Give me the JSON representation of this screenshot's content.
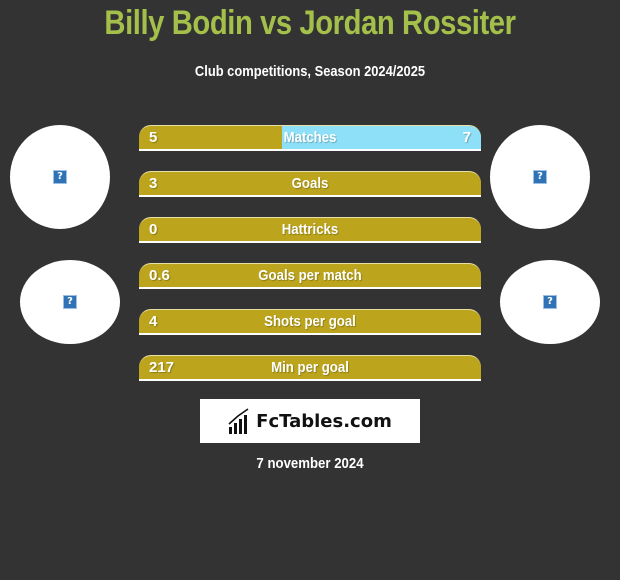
{
  "header": {
    "title": "Billy Bodin vs Jordan Rossiter",
    "subtitle": "Club competitions, Season 2024/2025"
  },
  "players": {
    "left": {
      "name": "Billy Bodin",
      "avatar_icon": "broken-image-icon",
      "club_icon": "broken-image-icon"
    },
    "right": {
      "name": "Jordan Rossiter",
      "avatar_icon": "broken-image-icon",
      "club_icon": "broken-image-icon"
    }
  },
  "colors": {
    "title": "#a4c04a",
    "left_bar": "#bca51c",
    "right_bar": "#8ee0f8",
    "background": "#333333"
  },
  "stats": [
    {
      "label": "Matches",
      "left": "5",
      "right": "7",
      "right_share": 0.583
    },
    {
      "label": "Goals",
      "left": "3",
      "right": "",
      "right_share": 0
    },
    {
      "label": "Hattricks",
      "left": "0",
      "right": "",
      "right_share": 0
    },
    {
      "label": "Goals per match",
      "left": "0.6",
      "right": "",
      "right_share": 0
    },
    {
      "label": "Shots per goal",
      "left": "4",
      "right": "",
      "right_share": 0
    },
    {
      "label": "Min per goal",
      "left": "217",
      "right": "",
      "right_share": 0
    }
  ],
  "footer": {
    "logo_text": "FcTables.com",
    "logo_icon": "bar-chart-icon",
    "date": "7 november 2024"
  }
}
